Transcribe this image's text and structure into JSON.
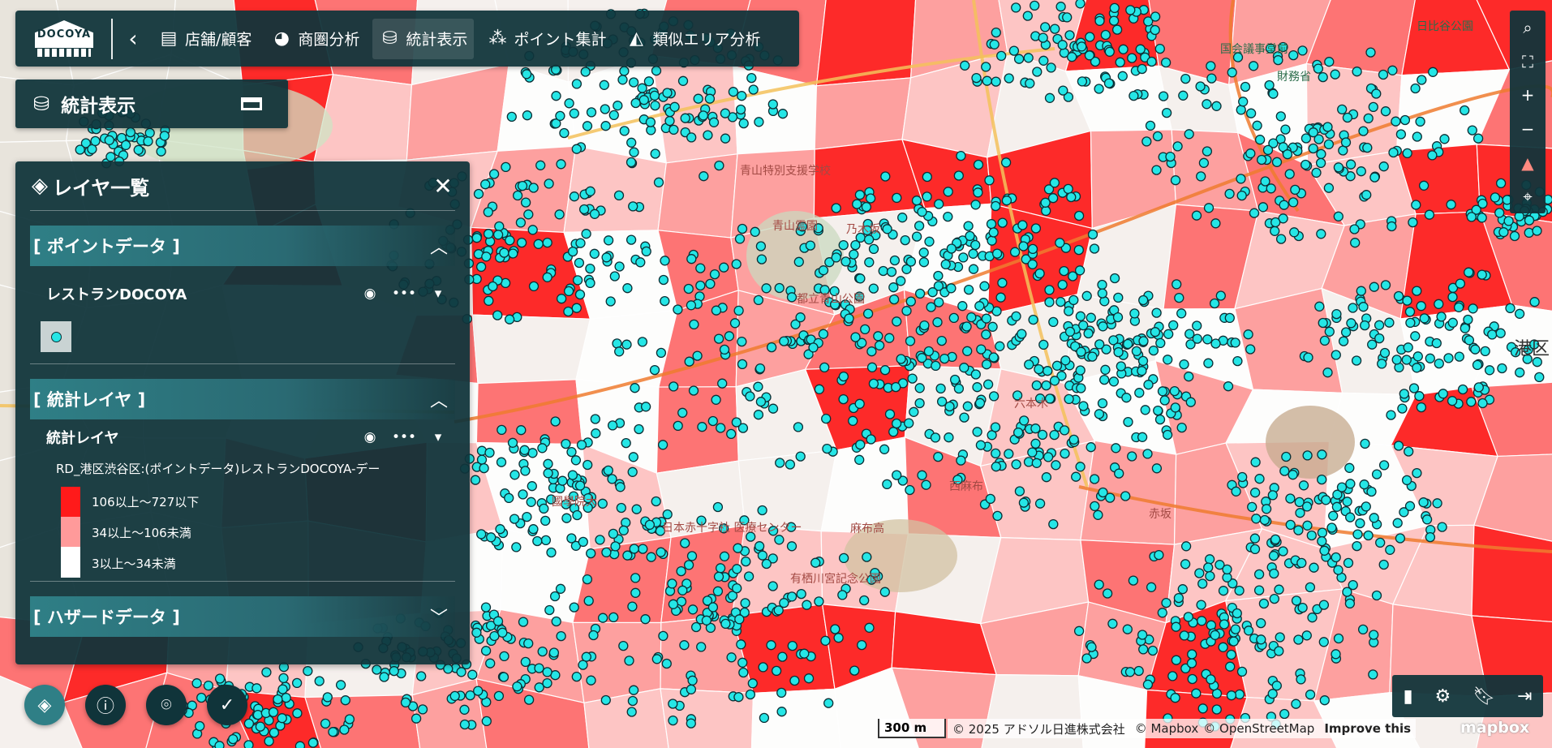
{
  "nav": {
    "logo_text": "DOCOYA",
    "back_icon": "chevron-left-icon",
    "items": [
      {
        "label": "店舗/顧客",
        "icon": "store-icon",
        "active": false
      },
      {
        "label": "商圏分析",
        "icon": "pie-icon",
        "active": false
      },
      {
        "label": "統計表示",
        "icon": "stats-layer-icon",
        "active": true
      },
      {
        "label": "ポイント集計",
        "icon": "point-aggregate-icon",
        "active": false
      },
      {
        "label": "類似エリア分析",
        "icon": "area-chart-icon",
        "active": false
      }
    ]
  },
  "stat_panel": {
    "title": "統計表示"
  },
  "layer_panel": {
    "title": "レイヤ一覧",
    "sections": {
      "point": {
        "label": "[ ポイントデータ ]",
        "expanded": true
      },
      "stat": {
        "label": "[ 統計レイヤ ]",
        "expanded": true
      },
      "hazard": {
        "label": "[ ハザードデータ ]",
        "expanded": false
      }
    },
    "point_layer": {
      "name": "レストランDOCOYA"
    },
    "stat_layer": {
      "name": "統計レイヤ",
      "legend_title": "RD_港区渋谷区:(ポイントデータ)レストランDOCOYA-デー",
      "legend_items": [
        {
          "label": "106以上～727以下",
          "color": "#ff1a1a"
        },
        {
          "label": "34以上～106未満",
          "color": "#ff9a9a"
        },
        {
          "label": "3以上～34未満",
          "color": "#ffffff"
        }
      ]
    }
  },
  "map": {
    "labels": [
      "青山特別支援学校",
      "青山霊園",
      "乃木坂",
      "都立青山公園",
      "港区",
      "国会議事堂前",
      "財務省",
      "日比谷公園",
      "日本赤十字社 医療センター",
      "有栖川宮記念公園",
      "國學院大",
      "麻布高",
      "赤坂",
      "六本木",
      "西麻布"
    ],
    "scale": "300 m",
    "attribution": "© 2025 アドソル日進株式会社",
    "attribution_links": [
      "© Mapbox",
      "© OpenStreetMap",
      "Improve this"
    ],
    "brand": "mapbox",
    "colors": {
      "high": "#ff1a1a",
      "mid": "#ff9a9a",
      "low": "#ffffff",
      "point": "#25e6e6"
    }
  },
  "map_tools": [
    "search-icon",
    "fullscreen-icon",
    "zoom-in-icon",
    "zoom-out-icon",
    "compass-icon",
    "locate-icon"
  ],
  "bottom_left_buttons": [
    "layers-icon",
    "info-icon",
    "pin-icon",
    "check-add-icon"
  ],
  "bottom_right_buttons": [
    "book-icon",
    "gear-icon",
    "bookmark-icon",
    "logout-icon"
  ]
}
